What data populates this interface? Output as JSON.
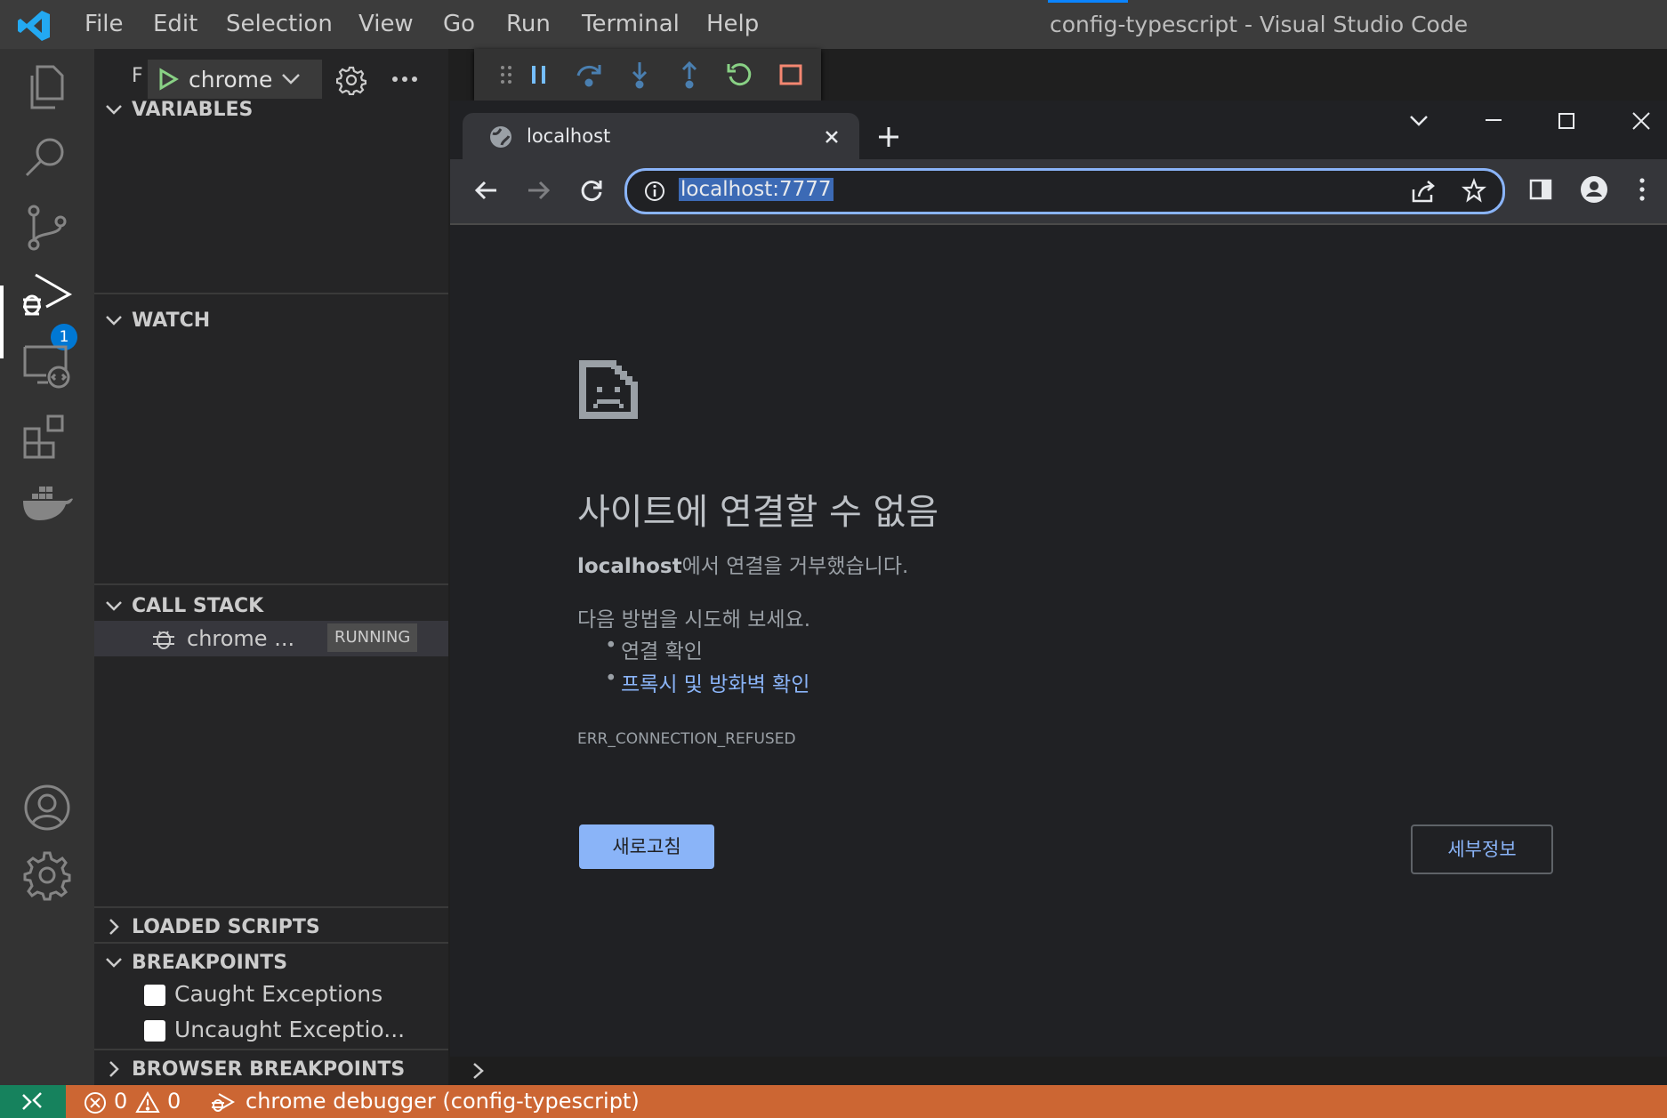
{
  "window": {
    "title": "config-typescript - Visual Studio Code"
  },
  "menu": [
    "File",
    "Edit",
    "Selection",
    "View",
    "Go",
    "Run",
    "Terminal",
    "Help"
  ],
  "activity_bar": {
    "items": [
      "explorer-icon",
      "search-icon",
      "source-control-icon",
      "run-debug-icon",
      "remote-explorer-icon",
      "extensions-icon",
      "docker-icon"
    ],
    "bottom": [
      "account-icon",
      "manage-gear-icon"
    ],
    "debug_badge": "1"
  },
  "sidebar": {
    "run_label": "F",
    "debug_config": "chrome",
    "sections": {
      "variables": "VARIABLES",
      "watch": "WATCH",
      "call_stack": "CALL STACK",
      "loaded_scripts": "LOADED SCRIPTS",
      "breakpoints": "BREAKPOINTS",
      "browser_breakpoints": "BROWSER BREAKPOINTS"
    },
    "call_stack_item": {
      "name": "chrome ...",
      "status": "RUNNING"
    },
    "breakpoints": [
      "Caught Exceptions",
      "Uncaught Exceptio..."
    ]
  },
  "debug_toolbar": [
    "drag-handle-icon",
    "pause-icon",
    "step-over-icon",
    "step-into-icon",
    "step-out-icon",
    "restart-icon",
    "stop-icon"
  ],
  "browser": {
    "tab_title": "localhost",
    "url": "localhost:7777",
    "error": {
      "title": "사이트에 연결할 수 없음",
      "host": "localhost",
      "message_suffix": "에서 연결을 거부했습니다.",
      "try_heading": "다음 방법을 시도해 보세요.",
      "suggestion_1": "연결 확인",
      "suggestion_2": "프록시 및 방화벽 확인",
      "code": "ERR_CONNECTION_REFUSED",
      "reload_button": "새로고침",
      "details_button": "세부정보"
    }
  },
  "status_bar": {
    "errors": "0",
    "warnings": "0",
    "debug_label": "chrome debugger (config-typescript)"
  },
  "colors": {
    "status_bar": "#cc6633",
    "remote": "#16825d",
    "link": "#8ab4f8",
    "accent_blue": "#0078d4"
  }
}
